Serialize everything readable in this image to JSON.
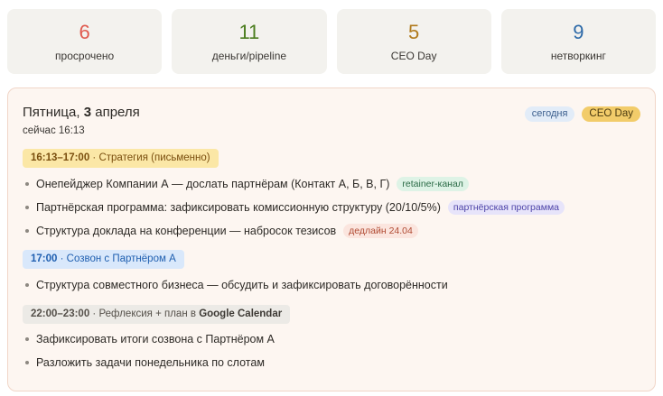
{
  "stats": [
    {
      "value": "6",
      "label": "просрочено",
      "color": "#e05a4e"
    },
    {
      "value": "11",
      "label": "деньги/pipeline",
      "color": "#4b7d1e"
    },
    {
      "value": "5",
      "label": "CEO Day",
      "color": "#b07a1c"
    },
    {
      "value": "9",
      "label": "нетворкинг",
      "color": "#2d6aa8"
    }
  ],
  "day": {
    "weekday": "Пятница, ",
    "date_num": "3",
    "month": " апреля",
    "now": "сейчас 16:13",
    "badges": [
      "сегодня",
      "CEO Day"
    ]
  },
  "slots": [
    {
      "time": "16:13–17:00",
      "title": " · Стратегия (письменно)",
      "items": [
        {
          "text": "Онепейджер Компании А — дослать партнёрам (Контакт А, Б, В, Г)",
          "tag": "retainer-канал"
        },
        {
          "text": "Партнёрская программа: зафиксировать комиссионную структуру (20/10/5%)",
          "tag": "партнёрская программа"
        },
        {
          "text": "Структура доклада на конференции — набросок тезисов",
          "tag": "дедлайн 24.04"
        }
      ]
    },
    {
      "time": "17:00",
      "title": " · Созвон с Партнёром А",
      "items": [
        {
          "text": "Структура совместного бизнеса — обсудить и зафиксировать договорённости"
        }
      ]
    },
    {
      "time": "22:00–23:00",
      "title": " · Рефлексия + план в ",
      "title_bold": "Google Calendar",
      "items": [
        {
          "text": "Зафиксировать итоги созвона с Партнёром А"
        },
        {
          "text": "Разложить задачи понедельника по слотам"
        }
      ]
    }
  ]
}
